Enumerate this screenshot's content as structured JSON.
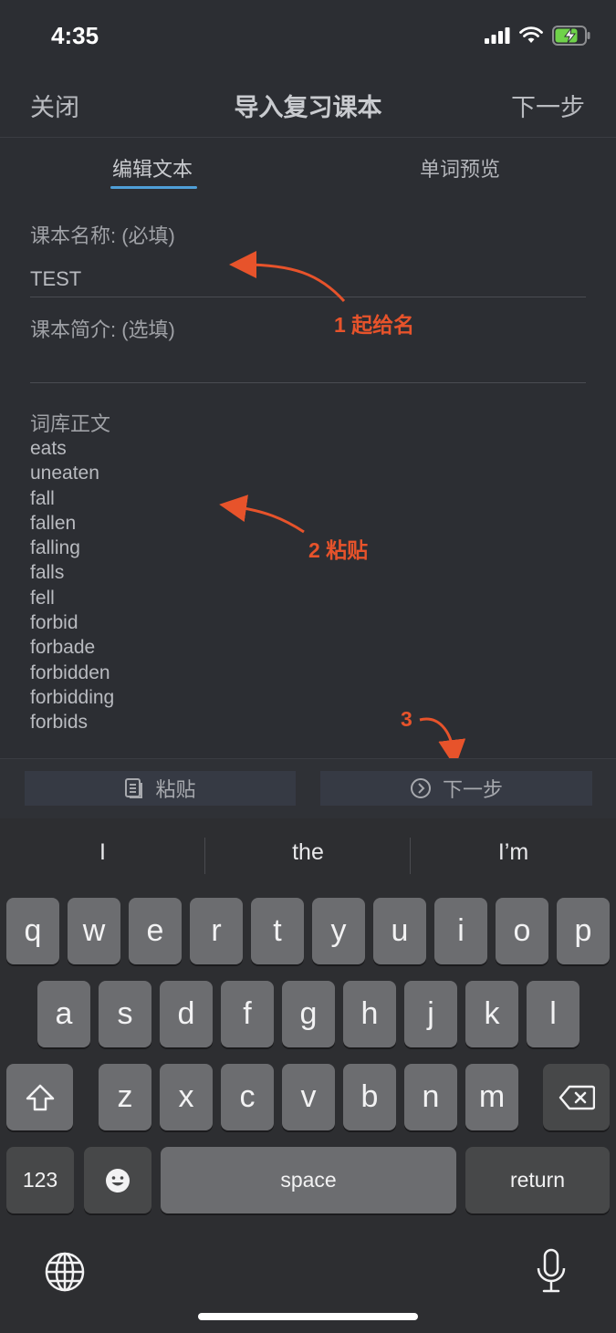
{
  "status": {
    "time": "4:35"
  },
  "nav": {
    "close": "关闭",
    "title": "导入复习课本",
    "next": "下一步"
  },
  "tabs": [
    {
      "label": "编辑文本"
    },
    {
      "label": "单词预览"
    }
  ],
  "form": {
    "name_label": "课本名称: (必填)",
    "name_value": "TEST",
    "intro_label": "课本简介: (选填)",
    "intro_value": "",
    "body_label": "词库正文",
    "words": [
      "eats",
      "uneaten",
      "fall",
      "fallen",
      "falling",
      "falls",
      "fell",
      "forbid",
      "forbade",
      "forbidden",
      "forbidding",
      "forbids"
    ]
  },
  "annotations": {
    "a1": "1 起给名",
    "a2": "2 粘贴",
    "a3": "3"
  },
  "toolbar": {
    "paste": "粘贴",
    "next": "下一步"
  },
  "keyboard": {
    "suggestions": [
      "I",
      "the",
      "I’m"
    ],
    "row1": [
      "q",
      "w",
      "e",
      "r",
      "t",
      "y",
      "u",
      "i",
      "o",
      "p"
    ],
    "row2": [
      "a",
      "s",
      "d",
      "f",
      "g",
      "h",
      "j",
      "k",
      "l"
    ],
    "row3": [
      "z",
      "x",
      "c",
      "v",
      "b",
      "n",
      "m"
    ],
    "numbers": "123",
    "space": "space",
    "return": "return"
  },
  "colors": {
    "accent": "#4f9fd8",
    "annotation": "#e7532b"
  }
}
